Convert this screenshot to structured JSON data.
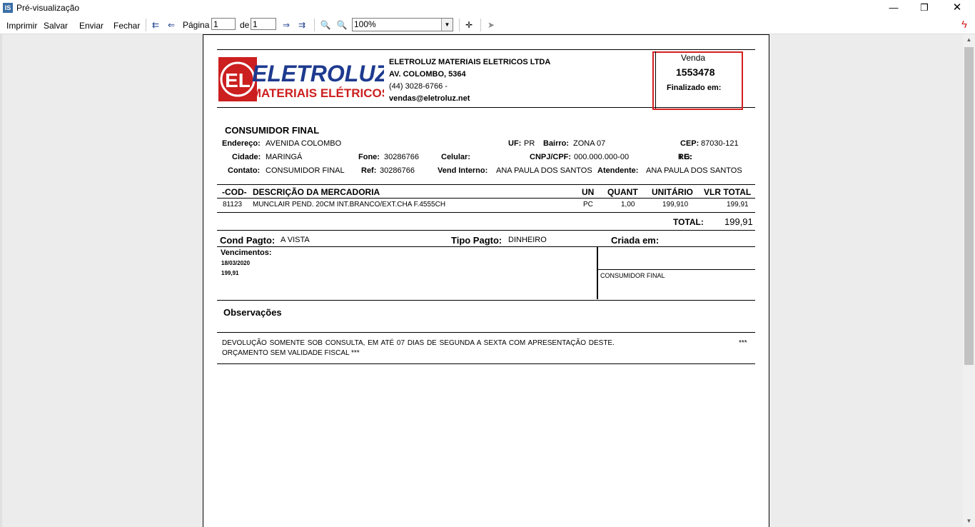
{
  "window": {
    "title": "Pré-visualização",
    "app_icon": "IS",
    "controls": {
      "minimize": "—",
      "restore": "❐",
      "close": "✕"
    }
  },
  "toolbar": {
    "print": "Imprimir",
    "save": "Salvar",
    "send": "Enviar",
    "close": "Fechar",
    "page_label": "Página",
    "page_value": "1",
    "of_label": "de",
    "total_pages": "1",
    "zoom_value": "100%"
  },
  "doc": {
    "company": {
      "logo_line1": "ELETROLUZ",
      "logo_line2": "MATERIAIS ELÉTRICOS",
      "logo_mark": "EL",
      "name": "ELETROLUZ MATERIAIS ELETRICOS LTDA",
      "address": "AV. COLOMBO, 5364",
      "phone": "(44) 3028-6766 -",
      "email": "vendas@eletroluz.net"
    },
    "sale": {
      "label": "Venda",
      "number": "1553478",
      "finalized_label": "Finalizado em:"
    },
    "customer": {
      "name": "CONSUMIDOR FINAL",
      "address_label": "Endereço:",
      "address": "AVENIDA COLOMBO",
      "uf_label": "UF:",
      "uf": "PR",
      "district_label": "Bairro:",
      "district": "ZONA 07",
      "cep_label": "CEP:",
      "cep": "87030-121",
      "city_label": "Cidade:",
      "city": "MARINGÁ",
      "phone_label": "Fone:",
      "phone": "30286766",
      "mobile_label": "Celular:",
      "cnpj_label": "CNPJ/CPF:",
      "cnpj": "000.000.000-00",
      "rg_label": "RG:",
      "ie_label": "I.E:",
      "contact_label": "Contato:",
      "contact": "CONSUMIDOR FINAL",
      "ref_label": "Ref:",
      "ref": "30286766",
      "seller_label": "Vend Interno:",
      "seller": "ANA PAULA DOS SANTOS",
      "attendant_label": "Atendente:",
      "attendant": "ANA PAULA DOS SANTOS"
    },
    "items_header": {
      "cod": "-COD-",
      "desc": "DESCRIÇÃO DA MERCADORIA",
      "un": "UN",
      "qty": "QUANT",
      "unit": "UNITÁRIO",
      "total": "VLR TOTAL"
    },
    "items": [
      {
        "cod": "81123",
        "desc": "MUNCLAIR PEND. 20CM INT.BRANCO/EXT.CHA F.4555CH",
        "un": "PC",
        "qty": "1,00",
        "unit": "199,910",
        "total": "199,91"
      }
    ],
    "total_label": "TOTAL:",
    "total_value": "199,91",
    "payment": {
      "cond_label": "Cond Pagto:",
      "cond": "A VISTA",
      "type_label": "Tipo Pagto:",
      "type": "DINHEIRO",
      "created_label": "Criada em:",
      "due_label": "Vencimentos:",
      "due_date": "18/03/2020",
      "due_value": "199,91",
      "signature_name": "CONSUMIDOR FINAL"
    },
    "notes": {
      "title": "Observações",
      "line1": "DEVOLUÇÃO SOMENTE SOB CONSULTA, EM ATÉ  07  DIAS  DE  SEGUNDA  A  SEXTA  COM  APRESENTAÇÃO  DESTE.",
      "stars": "***",
      "line2": "ORÇAMENTO SEM VALIDADE FISCAL  ***"
    }
  }
}
